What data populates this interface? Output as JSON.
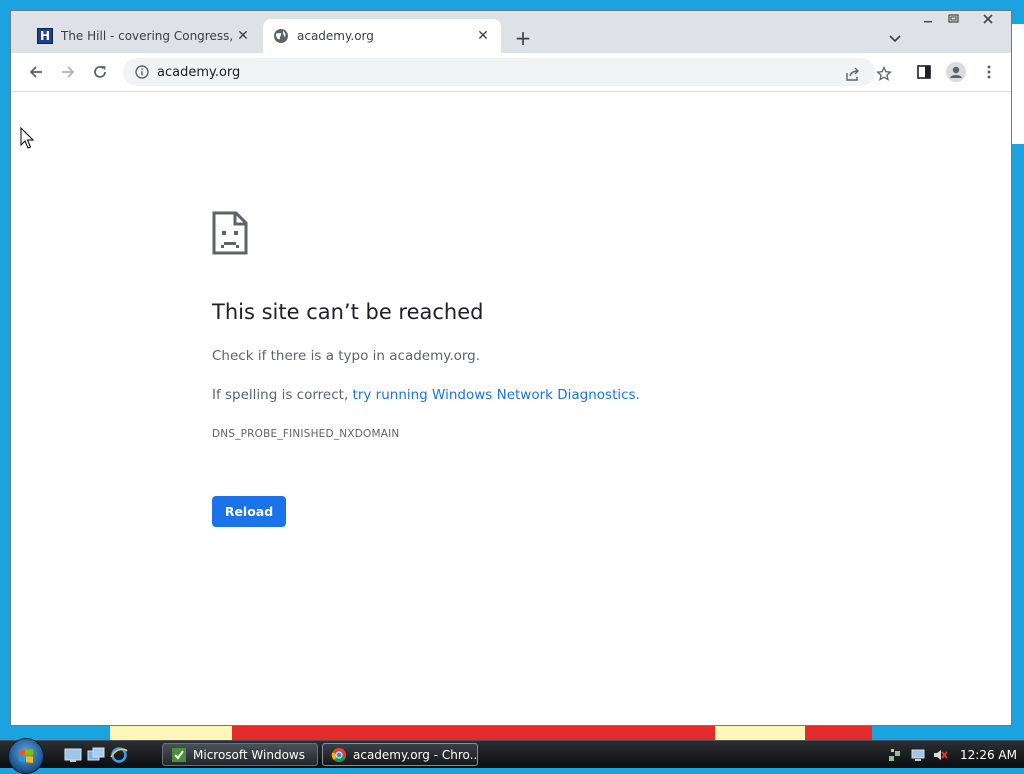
{
  "browser": {
    "tabs": [
      {
        "title": "The Hill - covering Congress, Pol",
        "active": false,
        "favicon": "the-hill-favicon"
      },
      {
        "title": "academy.org",
        "active": true,
        "favicon": "globe-icon"
      }
    ],
    "address_bar": {
      "url": "academy.org"
    }
  },
  "error_page": {
    "title": "This site can’t be reached",
    "line1": "Check if there is a typo in academy.org.",
    "line2_prefix": "If spelling is correct, ",
    "line2_link": "try running Windows Network Diagnostics",
    "line2_suffix": ".",
    "error_code": "DNS_PROBE_FINISHED_NXDOMAIN",
    "reload_label": "Reload"
  },
  "taskbar": {
    "items": [
      {
        "label": "Microsoft Windows",
        "active": false
      },
      {
        "label": "academy.org - Chro...",
        "active": true
      }
    ],
    "clock": "12:26 AM"
  },
  "colors": {
    "accent": "#1a73e8",
    "desktop": "#1aa3de",
    "tabstrip": "#dee1e6"
  }
}
